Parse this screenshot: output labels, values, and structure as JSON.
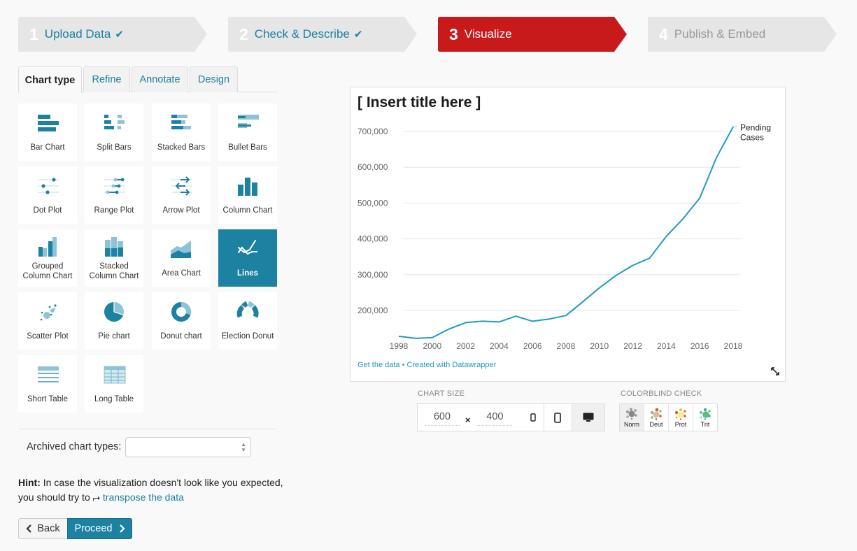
{
  "steps": [
    {
      "num": "1",
      "label": "Upload Data",
      "done": true,
      "state": "done"
    },
    {
      "num": "2",
      "label": "Check & Describe",
      "done": true,
      "state": "done"
    },
    {
      "num": "3",
      "label": "Visualize",
      "done": false,
      "state": "active"
    },
    {
      "num": "4",
      "label": "Publish & Embed",
      "done": false,
      "state": "upcoming"
    }
  ],
  "icons": {
    "check": "✔",
    "chevron_left": "‹",
    "chevron_right": "›",
    "resize": "⤡",
    "transpose": "⮣"
  },
  "colors": {
    "accent": "#1d81a2",
    "active_step": "#c8191b",
    "step_bg": "#e6e6e6",
    "line": "#1d9bc6"
  },
  "tabs": [
    {
      "label": "Chart type",
      "active": true
    },
    {
      "label": "Refine",
      "active": false
    },
    {
      "label": "Annotate",
      "active": false
    },
    {
      "label": "Design",
      "active": false
    }
  ],
  "chart_types": [
    {
      "label": "Bar Chart",
      "icon": "bar-chart-icon"
    },
    {
      "label": "Split Bars",
      "icon": "split-bars-icon"
    },
    {
      "label": "Stacked Bars",
      "icon": "stacked-bars-icon"
    },
    {
      "label": "Bullet Bars",
      "icon": "bullet-bars-icon"
    },
    {
      "label": "Dot Plot",
      "icon": "dot-plot-icon"
    },
    {
      "label": "Range Plot",
      "icon": "range-plot-icon"
    },
    {
      "label": "Arrow Plot",
      "icon": "arrow-plot-icon"
    },
    {
      "label": "Column Chart",
      "icon": "column-chart-icon"
    },
    {
      "label": "Grouped Column Chart",
      "line1": "Grouped",
      "line2": "Column Chart",
      "icon": "grouped-column-chart-icon"
    },
    {
      "label": "Stacked Column Chart",
      "line1": "Stacked",
      "line2": "Column Chart",
      "icon": "stacked-column-chart-icon"
    },
    {
      "label": "Area Chart",
      "icon": "area-chart-icon"
    },
    {
      "label": "Lines",
      "icon": "lines-icon",
      "selected": true
    },
    {
      "label": "Scatter Plot",
      "icon": "scatter-plot-icon"
    },
    {
      "label": "Pie chart",
      "icon": "pie-chart-icon"
    },
    {
      "label": "Donut chart",
      "icon": "donut-chart-icon"
    },
    {
      "label": "Election Donut",
      "icon": "election-donut-icon"
    },
    {
      "label": "Short Table",
      "icon": "short-table-icon"
    },
    {
      "label": "Long Table",
      "icon": "long-table-icon"
    }
  ],
  "archived": {
    "label": "Archived chart types:",
    "value": ""
  },
  "hint": {
    "bold": "Hint:",
    "text": " In case the visualization doesn't look like you expected, you should try to ",
    "link": "transpose the data"
  },
  "buttons": {
    "back": "Back",
    "proceed": "Proceed"
  },
  "preview": {
    "footer_get_data": "Get the data",
    "footer_sep": " • ",
    "footer_created": "Created with Datawrapper"
  },
  "chart_size": {
    "label": "CHART SIZE",
    "width": "600",
    "height": "400",
    "times": "×",
    "devices": [
      "mobile-small",
      "mobile",
      "desktop"
    ],
    "active_device": "desktop"
  },
  "colorblind": {
    "label": "COLORBLIND CHECK",
    "modes": [
      {
        "label": "Norm",
        "active": true
      },
      {
        "label": "Deut",
        "active": false
      },
      {
        "label": "Prot",
        "active": false
      },
      {
        "label": "Trit",
        "active": false
      }
    ]
  },
  "chart_data": {
    "type": "line",
    "title": "[ Insert title here ]",
    "xlabel": "",
    "ylabel": "",
    "x": [
      1998,
      1999,
      2000,
      2001,
      2002,
      2003,
      2004,
      2005,
      2006,
      2007,
      2008,
      2009,
      2010,
      2011,
      2012,
      2013,
      2014,
      2015,
      2016,
      2017,
      2018
    ],
    "series": [
      {
        "name": "Pending Cases",
        "label_lines": [
          "Pending",
          "Cases"
        ],
        "values": [
          128000,
          122000,
          124000,
          148000,
          166000,
          170000,
          168000,
          184000,
          170000,
          176000,
          186000,
          224000,
          263000,
          298000,
          326000,
          346000,
          407000,
          456000,
          514000,
          627000,
          713000
        ]
      }
    ],
    "x_ticks": [
      "1998",
      "2000",
      "2002",
      "2004",
      "2006",
      "2008",
      "2010",
      "2012",
      "2014",
      "2016",
      "2018"
    ],
    "y_ticks": [
      "200,000",
      "300,000",
      "400,000",
      "500,000",
      "600,000",
      "700,000"
    ],
    "y_tick_values": [
      200000,
      300000,
      400000,
      500000,
      600000,
      700000
    ],
    "xlim": [
      1998,
      2018
    ],
    "ylim": [
      115000,
      720000
    ],
    "grid": true,
    "legend": "direct-label-right"
  }
}
